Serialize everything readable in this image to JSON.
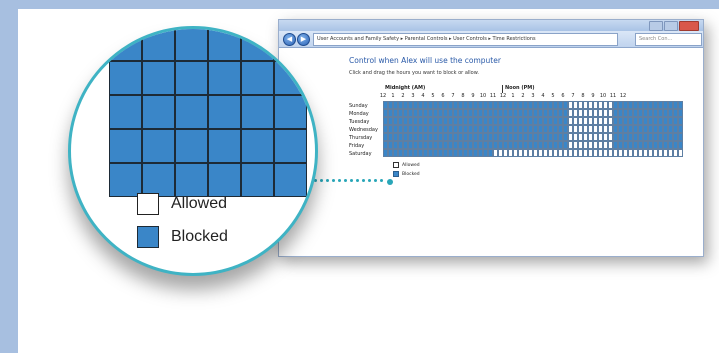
{
  "window": {
    "breadcrumb": "User Accounts and Family Safety ▸ Parental Controls ▸ User Controls ▸ Time Restrictions",
    "search_placeholder": "Search Con...",
    "back_glyph": "◀",
    "forward_glyph": "▶"
  },
  "time_restrictions": {
    "heading": "Control when Alex will use the computer",
    "instruction": "Click and drag the hours you want to block or allow.",
    "midnight_label": "Midnight (AM)",
    "noon_label": "Noon (PM)",
    "hour_labels": [
      "12",
      "1",
      "2",
      "3",
      "4",
      "5",
      "6",
      "7",
      "8",
      "9",
      "10",
      "11",
      "12",
      "1",
      "2",
      "3",
      "4",
      "5",
      "6",
      "7",
      "8",
      "9",
      "10",
      "11",
      "12"
    ],
    "days": [
      "Sunday",
      "Monday",
      "Tuesday",
      "Wednesday",
      "Thursday",
      "Friday",
      "Saturday"
    ],
    "grid": [
      "bbbbbbbbbbbbbbbbbbbbbbbbbbbbbbbbbbbbbaaaaaaaaabbbbbbbbbbbbbb",
      "bbbbbbbbbbbbbbbbbbbbbbbbbbbbbbbbbbbbbaaaaaaaaabbbbbbbbbbbbbb",
      "bbbbbbbbbbbbbbbbbbbbbbbbbbbbbbbbbbbbbaaaaaaaaabbbbbbbbbbbbbb",
      "bbbbbbbbbbbbbbbbbbbbbbbbbbbbbbbbbbbbbaaaaaaaaabbbbbbbbbbbbbb",
      "bbbbbbbbbbbbbbbbbbbbbbbbbbbbbbbbbbbbbaaaaaaaaabbbbbbbbbbbbbb",
      "bbbbbbbbbbbbbbbbbbbbbbbbbbbbbbbbbbbbbaaaaaaaaabbbbbbbbbbbbbb",
      "bbbbbbbbbbbbbbbbbbbbbbaaaaaaaaaaaaaaaaaaaaaaaaaaaaaaaaaaaaaa"
    ],
    "legend": {
      "allowed": "Allowed",
      "blocked": "Blocked"
    }
  },
  "magnified": {
    "legend": {
      "allowed": "Allowed",
      "blocked": "Blocked"
    }
  },
  "colors": {
    "blocked": "#3a86c8",
    "allowed": "#ffffff",
    "accent": "#3fb3c4",
    "heading": "#2a5aa8"
  }
}
